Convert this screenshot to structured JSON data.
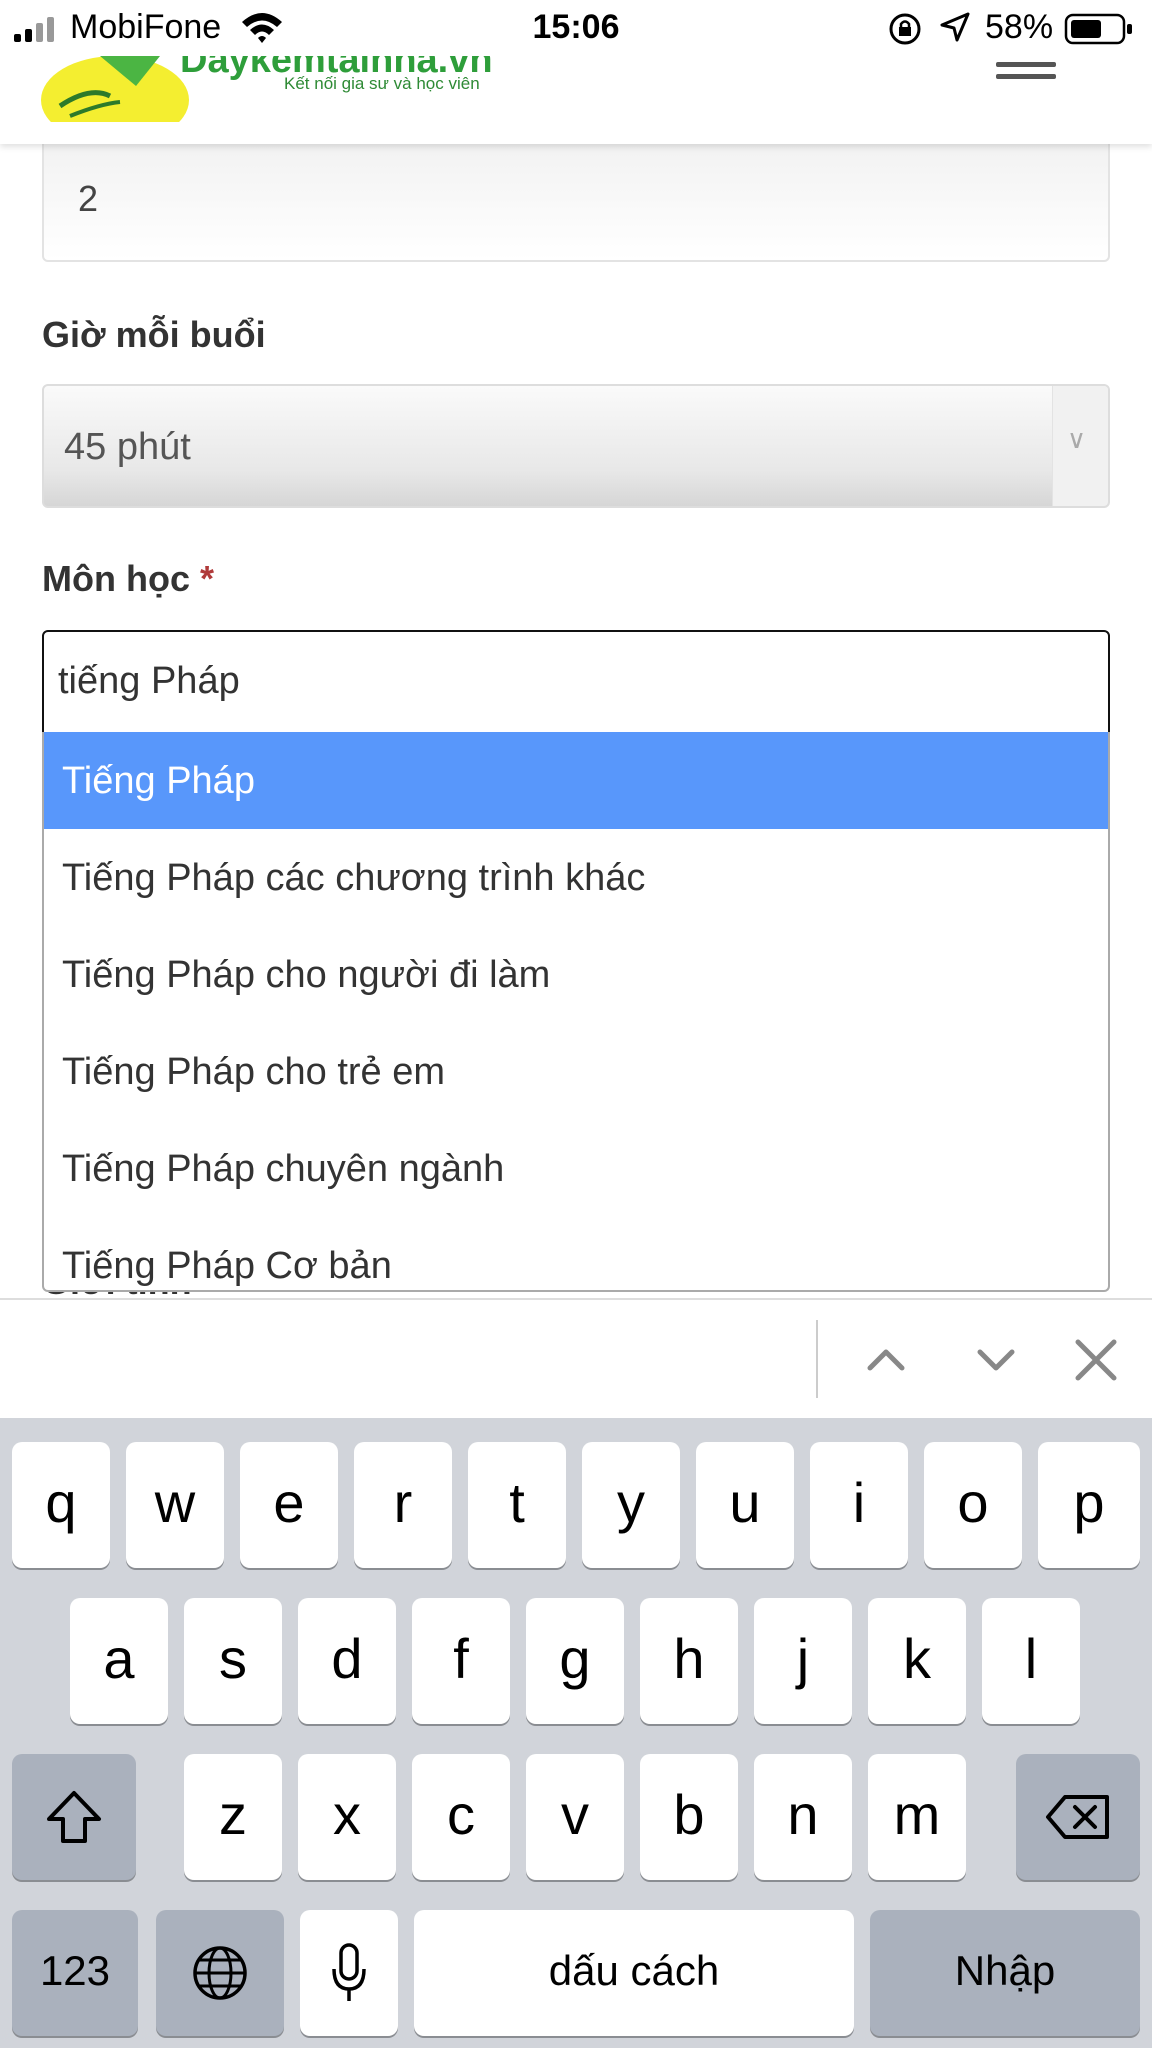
{
  "status_bar": {
    "carrier": "MobiFone",
    "time": "15:06",
    "battery": "58%"
  },
  "header": {
    "brand": "Daykemtainha.vn",
    "tagline": "Kết nối gia sư và học viên"
  },
  "form": {
    "sessions_value": "2",
    "hours_label": "Giờ mỗi buổi",
    "hours_value": "45 phút",
    "subject_label": "Môn học",
    "required_mark": "*",
    "subject_query": "tiếng Pháp",
    "hidden_next_label": "Giới tính"
  },
  "dropdown": {
    "options": [
      "Tiếng Pháp",
      "Tiếng Pháp các chương trình khác",
      "Tiếng Pháp cho người đi làm",
      "Tiếng Pháp cho trẻ em",
      "Tiếng Pháp chuyên ngành",
      "Tiếng Pháp Cơ bản"
    ],
    "selected_index": 0,
    "selected_color": "#5897fb"
  },
  "keyboard": {
    "row1": [
      "q",
      "w",
      "e",
      "r",
      "t",
      "y",
      "u",
      "i",
      "o",
      "p"
    ],
    "row2": [
      "a",
      "s",
      "d",
      "f",
      "g",
      "h",
      "j",
      "k",
      "l"
    ],
    "row3": [
      "z",
      "x",
      "c",
      "v",
      "b",
      "n",
      "m"
    ],
    "numbers_key": "123",
    "space_key": "dấu cách",
    "return_key": "Nhập"
  }
}
